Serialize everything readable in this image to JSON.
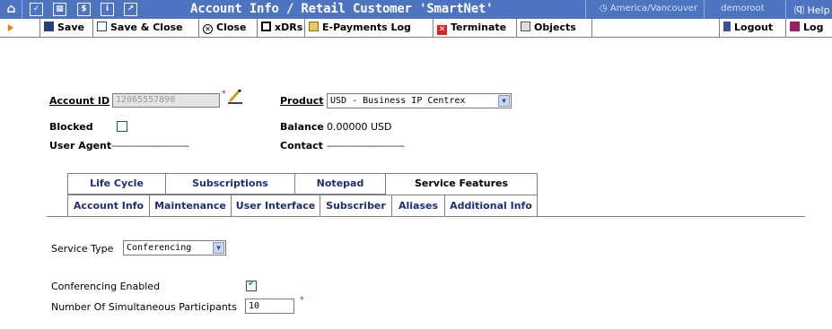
{
  "titlebar": {
    "title": "Account Info / Retail Customer 'SmartNet'",
    "timezone": "◷  America/Vancouver",
    "user": "demoroot",
    "help": "⒬ Help",
    "bg_color": "#4d74c0"
  },
  "toolbar": {
    "save": "Save",
    "save_close": "Save & Close",
    "close": "Close",
    "xdrs": "xDRs",
    "epayments": "E-Payments Log",
    "terminate": "Terminate",
    "objects": "Objects",
    "logout": "Logout",
    "log": "Log"
  },
  "account": {
    "account_id_label": "Account ID",
    "account_id_value": "12065557890",
    "blocked_label": "Blocked",
    "blocked_checked": false,
    "user_agent_label": "User Agent",
    "user_agent_value": "-----------------------------",
    "product_label": "Product",
    "product_value": "USD - Business IP Centrex",
    "balance_label": "Balance",
    "balance_value": "0.00000 USD",
    "contact_label": "Contact",
    "contact_value": "-----------------------------",
    "required_mark": "*"
  },
  "tabs": {
    "row1": [
      "Life Cycle",
      "Subscriptions",
      "Notepad",
      "Service Features"
    ],
    "row2": [
      "Account Info",
      "Maintenance",
      "User Interface",
      "Subscriber",
      "Aliases",
      "Additional Info"
    ],
    "active": "Service Features"
  },
  "features": {
    "service_type_label": "Service Type",
    "service_type_value": "Conferencing",
    "conf_enabled_label": "Conferencing Enabled",
    "conf_enabled_checked": true,
    "participants_label": "Number Of Simultaneous Participants",
    "participants_value": "10",
    "required_mark": "*"
  }
}
